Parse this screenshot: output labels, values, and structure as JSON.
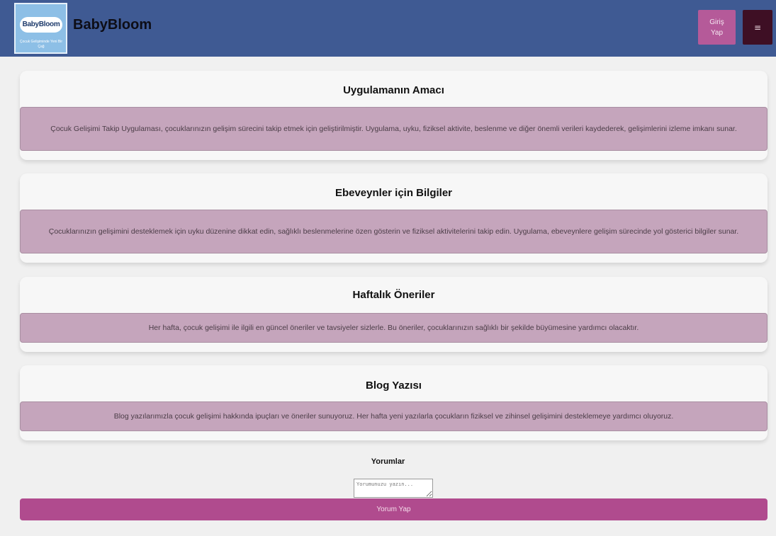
{
  "header": {
    "logo": {
      "title": "BabyBloom",
      "tagline": "Çocuk Gelişiminde Yeni Bir Çağ"
    },
    "brand": "BabyBloom",
    "login_label": "Giriş Yap",
    "menu_icon": "menu-icon",
    "menu_label": "≡"
  },
  "sections": [
    {
      "title": "Uygulamanın Amacı",
      "text": "Çocuk Gelişimi Takip Uygulaması, çocuklarınızın gelişim sürecini takip etmek için geliştirilmiştir. Uygulama, uyku, fiziksel aktivite, beslenme ve diğer önemli verileri kaydederek, gelişimlerini izleme imkanı sunar."
    },
    {
      "title": "Ebeveynler için Bilgiler",
      "text": "Çocuklarınızın gelişimini desteklemek için uyku düzenine dikkat edin, sağlıklı beslenmelerine özen gösterin ve fiziksel aktivitelerini takip edin. Uygulama, ebeveynlere gelişim sürecinde yol gösterici bilgiler sunar."
    },
    {
      "title": "Haftalık Öneriler",
      "text": "Her hafta, çocuk gelişimi ile ilgili en güncel öneriler ve tavsiyeler sizlerle. Bu öneriler, çocuklarınızın sağlıklı bir şekilde büyümesine yardımcı olacaktır."
    },
    {
      "title": "Blog Yazısı",
      "text": "Blog yazılarımızla çocuk gelişimi hakkında ipuçları ve öneriler sunuyoruz. Her hafta yeni yazılarla çocukların fiziksel ve zihinsel gelişimini desteklemeye yardımcı oluyoruz."
    }
  ],
  "comments": {
    "title": "Yorumlar",
    "placeholder": "Yorumunuzu yazın...",
    "value": "",
    "submit_label": "Yorum Yap"
  },
  "colors": {
    "navbar": "#3f5a93",
    "login_button": "#b55a99",
    "menu_button": "#3e0f24",
    "section_box": "#c5a5bc",
    "submit_button": "#b04b8e"
  }
}
